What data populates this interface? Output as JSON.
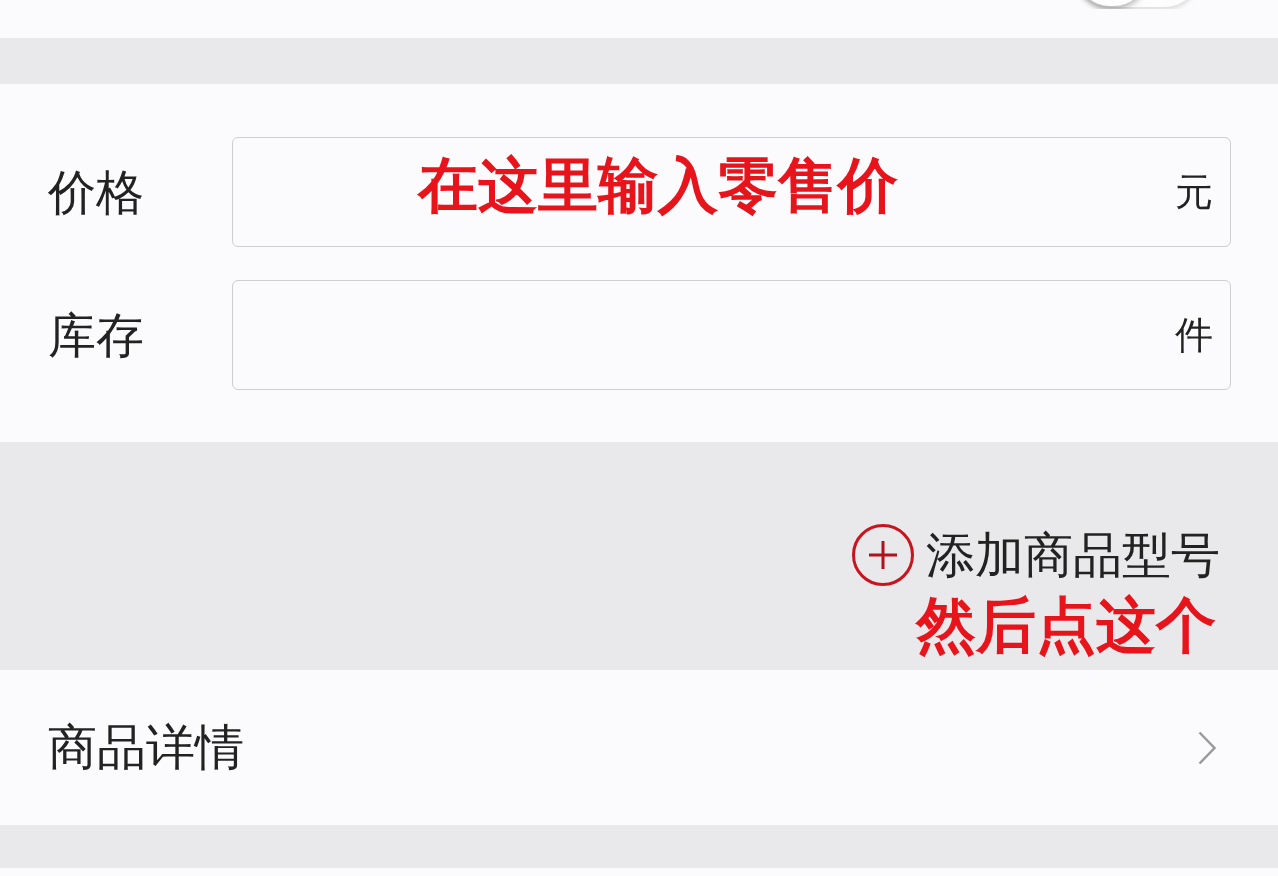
{
  "top_toggle": {
    "on": false
  },
  "form": {
    "fields": [
      {
        "label": "价格",
        "unit": "元",
        "annotation": "在这里输入零售价"
      },
      {
        "label": "库存",
        "unit": "件"
      }
    ]
  },
  "add_model_button": {
    "label": "添加商品型号",
    "annotation": "然后点这个"
  },
  "details_row": {
    "label": "商品详情"
  }
}
